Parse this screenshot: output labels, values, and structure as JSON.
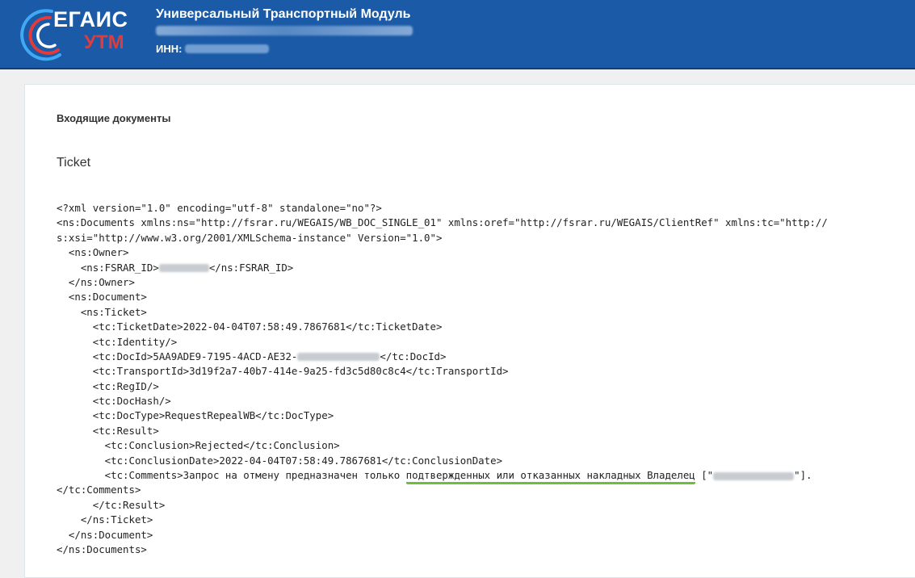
{
  "header": {
    "logo_egais": "ЕГАИС",
    "logo_utm": "УТМ",
    "app_title": "Универсальный Транспортный Модуль",
    "inn_label": "ИНН:"
  },
  "page": {
    "section_title": "Входящие документы",
    "doc_type": "Ticket"
  },
  "xml": {
    "l1": "<?xml version=\"1.0\" encoding=\"utf-8\" standalone=\"no\"?>",
    "l2": "<ns:Documents xmlns:ns=\"http://fsrar.ru/WEGAIS/WB_DOC_SINGLE_01\" xmlns:oref=\"http://fsrar.ru/WEGAIS/ClientRef\" xmlns:tc=\"http://",
    "l3": "s:xsi=\"http://www.w3.org/2001/XMLSchema-instance\" Version=\"1.0\">",
    "l4": "  <ns:Owner>",
    "l5a": "    <ns:FSRAR_ID>",
    "l5b": "</ns:FSRAR_ID>",
    "l6": "  </ns:Owner>",
    "l7": "  <ns:Document>",
    "l8": "    <ns:Ticket>",
    "l9": "      <tc:TicketDate>2022-04-04T07:58:49.7867681</tc:TicketDate>",
    "l10": "      <tc:Identity/>",
    "l11a": "      <tc:DocId>5AA9ADE9-7195-4ACD-AE32-",
    "l11b": "</tc:DocId>",
    "l12": "      <tc:TransportId>3d19f2a7-40b7-414e-9a25-fd3c5d80c8c4</tc:TransportId>",
    "l13": "      <tc:RegID/>",
    "l14": "      <tc:DocHash/>",
    "l15": "      <tc:DocType>RequestRepealWB</tc:DocType>",
    "l16": "      <tc:Result>",
    "l17": "        <tc:Conclusion>Rejected</tc:Conclusion>",
    "l18": "        <tc:ConclusionDate>2022-04-04T07:58:49.7867681</tc:ConclusionDate>",
    "l19a": "        <tc:Comments>Запрос на отмену предназначен только ",
    "l19b": "подтвержденных или отказанных накладных Владелец",
    "l19c": " [\"",
    "l19d": "\"].",
    "l20": "</tc:Comments>",
    "l21": "      </tc:Result>",
    "l22": "    </ns:Ticket>",
    "l23": "  </ns:Document>",
    "l24": "</ns:Documents>"
  }
}
